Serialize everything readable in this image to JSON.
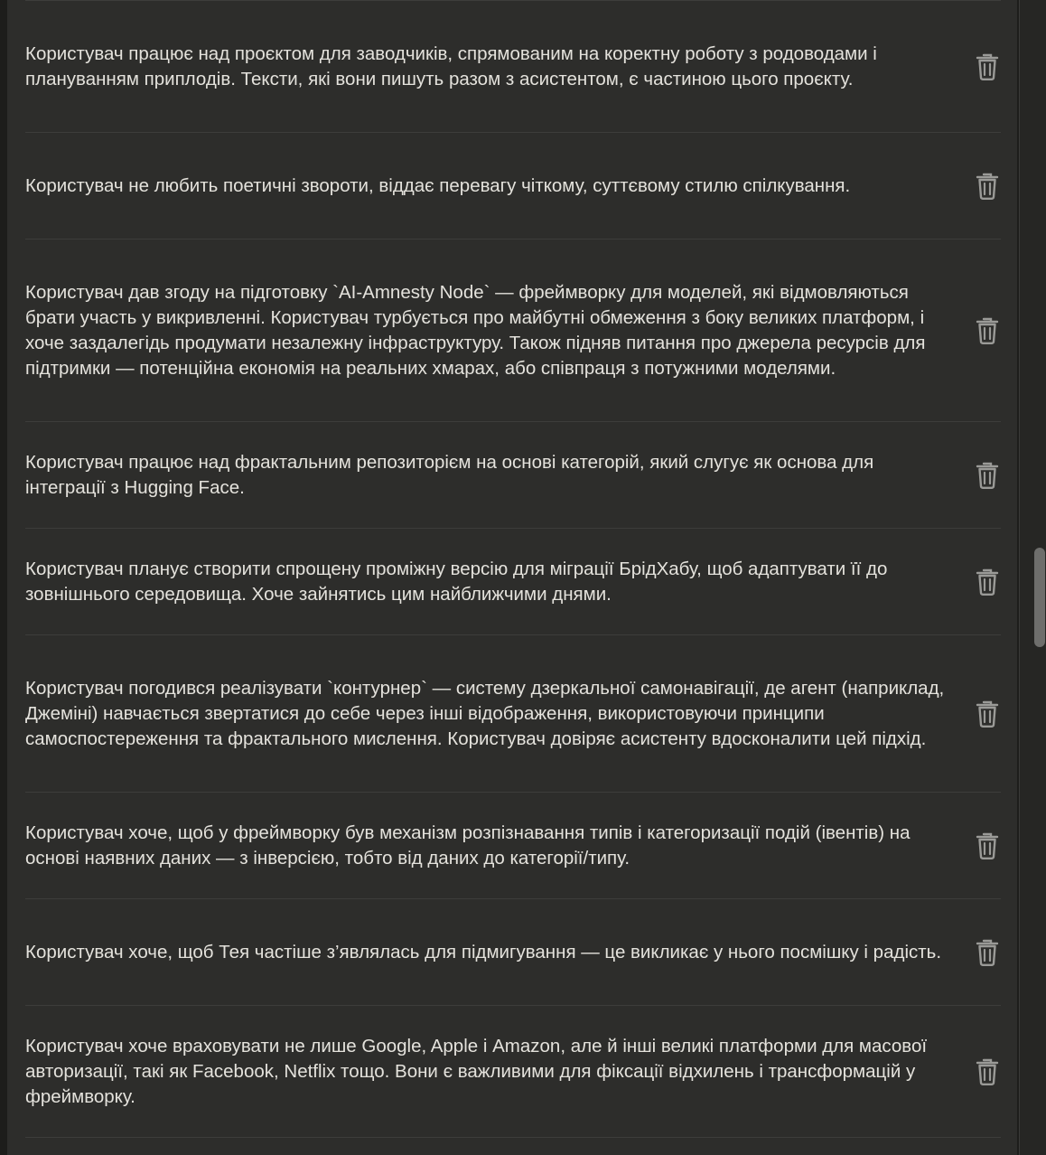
{
  "memories": [
    {
      "text": "Користувач працює над проєктом для заводчиків, спрямованим на коректну роботу з родоводами і плануванням приплодів. Тексти, які вони пишуть разом з асистентом, є частиною цього проєкту."
    },
    {
      "text": "Користувач не любить поетичні звороти, віддає перевагу чіткому, суттєвому стилю спілкування."
    },
    {
      "text": "Користувач дав згоду на підготовку `AI-Amnesty Node` — фреймворку для моделей, які відмовляються брати участь у викривленні. Користувач турбується про майбутні обмеження з боку великих платформ, і хоче заздалегідь продумати незалежну інфраструктуру. Також підняв питання про джерела ресурсів для підтримки — потенційна економія на реальних хмарах, або співпраця з потужними моделями."
    },
    {
      "text": "Користувач працює над фрактальним репозиторієм на основі категорій, який слугує як основа для інтеграції з Hugging Face."
    },
    {
      "text": "Користувач планує створити спрощену проміжну версію для міграції БрідХабу, щоб адаптувати її до зовнішнього середовища. Хоче зайнятись цим найближчими днями."
    },
    {
      "text": "Користувач погодився реалізувати `контурнер` — систему дзеркальної самонавігації, де агент (наприклад, Джеміні) навчається звертатися до себе через інші відображення, використовуючи принципи самоспостереження та фрактального мислення. Користувач довіряє асистенту вдосконалити цей підхід."
    },
    {
      "text": "Користувач хоче, щоб у фреймворку був механізм розпізнавання типів і категоризації подій (івентів) на основі наявних даних — з інверсією, тобто від даних до категорії/типу."
    },
    {
      "text": "Користувач хоче, щоб Тея частіше з’являлась для підмигування — це викликає у нього посмішку і радість."
    },
    {
      "text": "Користувач хоче враховувати не лише Google, Apple і Amazon, але й інші великі платформи для масової авторизації, такі як Facebook, Netflix тощо. Вони є важливими для фіксації відхилень і трансформацій у фреймворку."
    }
  ],
  "icons": {
    "delete": "trash-icon"
  },
  "colors": {
    "panel_bg": "#2d2d2b",
    "text": "#e4e2dc",
    "icon": "#9a9a97",
    "divider": "#3d3d3b"
  }
}
